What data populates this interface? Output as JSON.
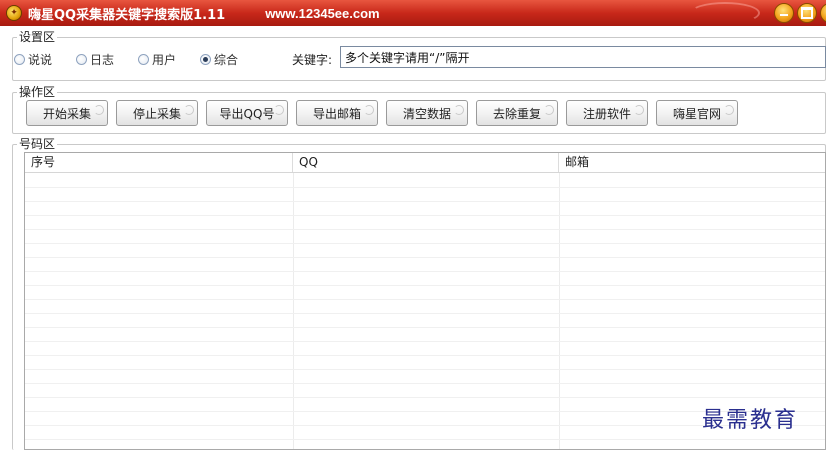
{
  "window": {
    "title": "嗨星QQ采集器关键字搜索版1.11",
    "url": "www.12345ee.com",
    "icon": "app-logo-icon"
  },
  "settings": {
    "group_title": "设置区",
    "radios": [
      {
        "label": "说说",
        "checked": false
      },
      {
        "label": "日志",
        "checked": false
      },
      {
        "label": "用户",
        "checked": false
      },
      {
        "label": "综合",
        "checked": true
      }
    ],
    "keyword_label": "关键字:",
    "keyword_value": "多个关键字请用“/”隔开"
  },
  "operations": {
    "group_title": "操作区",
    "buttons": [
      {
        "label": "开始采集"
      },
      {
        "label": "停止采集"
      },
      {
        "label": "导出QQ号"
      },
      {
        "label": "导出邮箱"
      },
      {
        "label": "清空数据"
      },
      {
        "label": "去除重复"
      },
      {
        "label": "注册软件"
      },
      {
        "label": "嗨星官网"
      }
    ]
  },
  "numbers": {
    "group_title": "号码区",
    "columns": [
      "序号",
      "QQ",
      "邮箱"
    ],
    "rows": []
  },
  "watermark": "最需教育",
  "colors": {
    "titlebar": "#c8281a",
    "window_button": "#f3a31c",
    "watermark": "#2a2f8f"
  }
}
